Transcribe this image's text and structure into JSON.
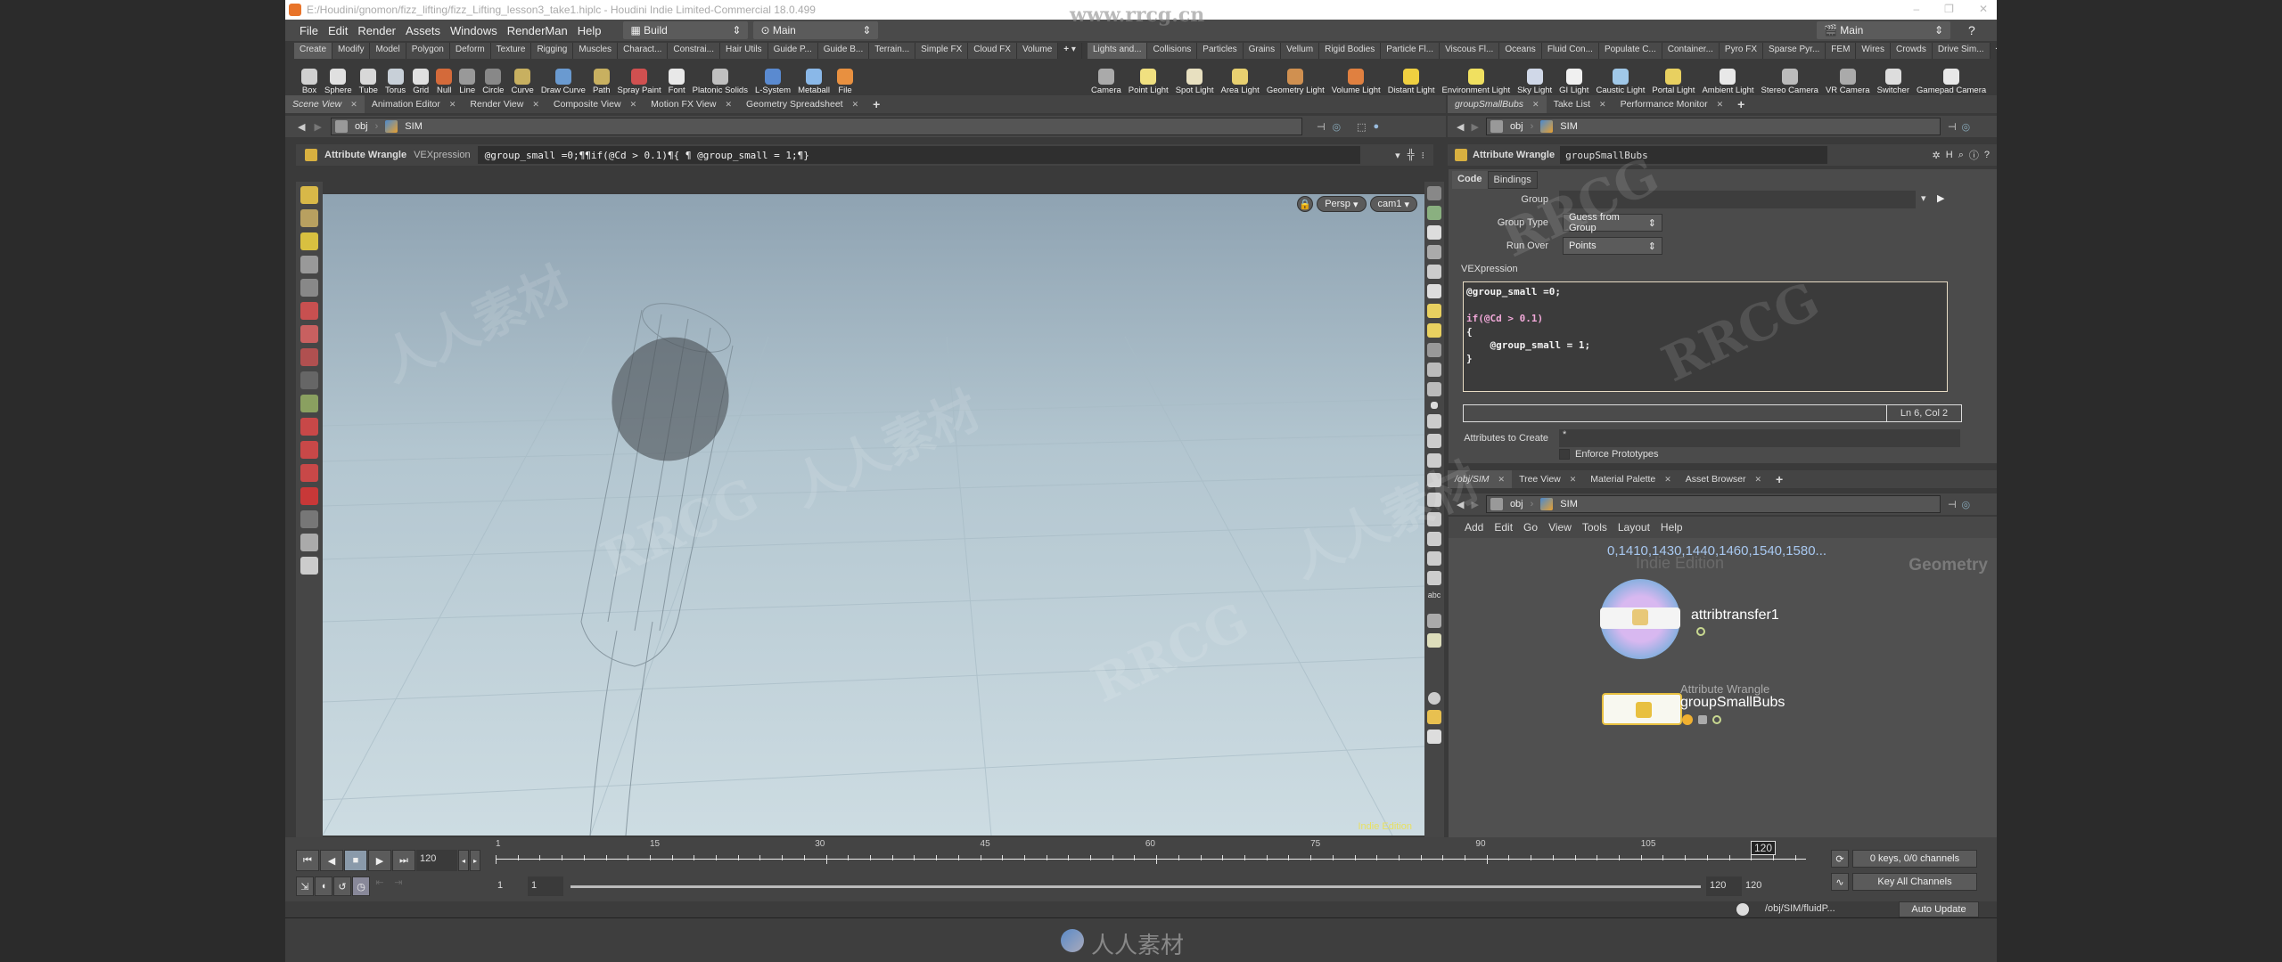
{
  "window": {
    "title": "E:/Houdini/gnomon/fizz_lifting/fizz_Lifting_lesson3_take1.hiplc - Houdini Indie Limited-Commercial 18.0.499",
    "controls": [
      "–",
      "❐",
      "✕"
    ]
  },
  "menubar": {
    "items": [
      "File",
      "Edit",
      "Render",
      "Assets",
      "Windows",
      "RenderMan",
      "Help"
    ],
    "desktop": "Build",
    "context": "Main",
    "right_context": "Main"
  },
  "shelf_tabs_left": [
    "Create",
    "Modify",
    "Model",
    "Polygon",
    "Deform",
    "Texture",
    "Rigging",
    "Muscles",
    "Charact...",
    "Constrai...",
    "Hair Utils",
    "Guide P...",
    "Guide B...",
    "Terrain...",
    "Simple FX",
    "Cloud FX",
    "Volume"
  ],
  "shelf_tabs_right": [
    "Lights and...",
    "Collisions",
    "Particles",
    "Grains",
    "Vellum",
    "Rigid Bodies",
    "Particle Fl...",
    "Viscous Fl...",
    "Oceans",
    "Fluid Con...",
    "Populate C...",
    "Container...",
    "Pyro FX",
    "Sparse Pyr...",
    "FEM",
    "Wires",
    "Crowds",
    "Drive Sim..."
  ],
  "shelf_tools_left": [
    {
      "label": "Box",
      "icon": "box-icon",
      "color": "#d0d0d0"
    },
    {
      "label": "Sphere",
      "icon": "sphere-icon",
      "color": "#e0e0e0"
    },
    {
      "label": "Tube",
      "icon": "tube-icon",
      "color": "#d8d8d8"
    },
    {
      "label": "Torus",
      "icon": "torus-icon",
      "color": "#c8d0d8"
    },
    {
      "label": "Grid",
      "icon": "grid-icon",
      "color": "#e0e0e0"
    },
    {
      "label": "Null",
      "icon": "null-icon",
      "color": "#d46a3a"
    },
    {
      "label": "Line",
      "icon": "line-icon",
      "color": "#999999"
    },
    {
      "label": "Circle",
      "icon": "circle-icon",
      "color": "#888888"
    },
    {
      "label": "Curve",
      "icon": "curve-icon",
      "color": "#c8b060"
    },
    {
      "label": "Draw Curve",
      "icon": "draw-curve-icon",
      "color": "#6a9ad0"
    },
    {
      "label": "Path",
      "icon": "path-icon",
      "color": "#c8b060"
    },
    {
      "label": "Spray Paint",
      "icon": "spray-paint-icon",
      "color": "#d05050"
    },
    {
      "label": "Font",
      "icon": "font-icon",
      "color": "#e8e8e8"
    },
    {
      "label": "Platonic Solids",
      "icon": "platonic-solids-icon",
      "color": "#c0c0c0"
    },
    {
      "label": "L-System",
      "icon": "l-system-icon",
      "color": "#5a8ad0"
    },
    {
      "label": "Metaball",
      "icon": "metaball-icon",
      "color": "#8ab8e8"
    },
    {
      "label": "File",
      "icon": "file-icon",
      "color": "#e89040"
    }
  ],
  "shelf_tools_right": [
    {
      "label": "Camera",
      "icon": "camera-icon",
      "color": "#aaaaaa"
    },
    {
      "label": "Point Light",
      "icon": "point-light-icon",
      "color": "#f0e080"
    },
    {
      "label": "Spot Light",
      "icon": "spot-light-icon",
      "color": "#e8e0c0"
    },
    {
      "label": "Area Light",
      "icon": "area-light-icon",
      "color": "#e8d070"
    },
    {
      "label": "Geometry Light",
      "icon": "geometry-light-icon",
      "color": "#d09050"
    },
    {
      "label": "Volume Light",
      "icon": "volume-light-icon",
      "color": "#e08040"
    },
    {
      "label": "Distant Light",
      "icon": "distant-light-icon",
      "color": "#f0d040"
    },
    {
      "label": "Environment Light",
      "icon": "environment-light-icon",
      "color": "#f0e060"
    },
    {
      "label": "Sky Light",
      "icon": "sky-light-icon",
      "color": "#d0d8e8"
    },
    {
      "label": "GI Light",
      "icon": "gi-light-icon",
      "color": "#f0f0f0"
    },
    {
      "label": "Caustic Light",
      "icon": "caustic-light-icon",
      "color": "#a0c8e8"
    },
    {
      "label": "Portal Light",
      "icon": "portal-light-icon",
      "color": "#e8d060"
    },
    {
      "label": "Ambient Light",
      "icon": "ambient-light-icon",
      "color": "#e8e8e8"
    },
    {
      "label": "Stereo Camera",
      "icon": "stereo-camera-icon",
      "color": "#bbbbbb"
    },
    {
      "label": "VR Camera",
      "icon": "vr-camera-icon",
      "color": "#aaaaaa"
    },
    {
      "label": "Switcher",
      "icon": "switcher-icon",
      "color": "#dddddd"
    },
    {
      "label": "Gamepad Camera",
      "icon": "gamepad-camera-icon",
      "color": "#e8e8e8"
    }
  ],
  "left_pane_tabs": [
    "Scene View",
    "Animation Editor",
    "Render View",
    "Composite View",
    "Motion FX View",
    "Geometry Spreadsheet"
  ],
  "right_top_tabs": [
    "groupSmallBubs",
    "Take List",
    "Performance Monitor"
  ],
  "right_bottom_tabs": [
    "/obj/SIM",
    "Tree View",
    "Material Palette",
    "Asset Browser"
  ],
  "path": {
    "root": "obj",
    "node": "SIM"
  },
  "viewport": {
    "op_type": "Attribute Wrangle",
    "op_field_label": "VEXpression",
    "vex_inline": "@group_small =0;¶¶if(@Cd > 0.1)¶{    ¶    @group_small = 1;¶}",
    "view_mode": "Persp",
    "camera": "cam1",
    "edition_label": "Indie Edition"
  },
  "params": {
    "op_type": "Attribute Wrangle",
    "node_name": "groupSmallBubs",
    "tabs": [
      "Code",
      "Bindings"
    ],
    "group_label": "Group",
    "group_value": "",
    "group_type_label": "Group Type",
    "group_type_value": "Guess from Group",
    "run_over_label": "Run Over",
    "run_over_value": "Points",
    "vex_label": "VEXpression",
    "code_lines": [
      "@group_small =0;",
      "",
      "if(@Cd > 0.1)",
      "{",
      "    @group_small = 1;",
      "}"
    ],
    "cursor_pos": "Ln 6, Col 2",
    "attrs_to_create_label": "Attributes to Create",
    "attrs_to_create_value": "*",
    "enforce_prototypes_label": "Enforce Prototypes",
    "enforce_prototypes": false
  },
  "network": {
    "menu": [
      "Add",
      "Edit",
      "Go",
      "View",
      "Tools",
      "Layout",
      "Help"
    ],
    "group_list_text": "0,1410,1430,1440,1460,1540,1580...",
    "watermark_edition": "Indie Edition",
    "context_label": "Geometry",
    "nodes": [
      {
        "type": "",
        "name": "attribtransfer1"
      },
      {
        "type": "Attribute Wrangle",
        "name": "groupSmallBubs"
      }
    ]
  },
  "timeline": {
    "current_frame": "120",
    "ticks": [
      "1",
      "15",
      "30",
      "45",
      "60",
      "75",
      "90",
      "105"
    ],
    "marker": "120",
    "range_start": "1",
    "range_start2": "1",
    "range_end": "120",
    "range_end2": "120",
    "keys_info": "0 keys, 0/0 channels",
    "key_mode": "Key All Channels",
    "status_path": "/obj/SIM/fluidP...",
    "update_mode": "Auto Update"
  },
  "watermarks": {
    "site": "www.rrcg.cn",
    "brand_cn": "人人素材",
    "brand_en": "RRCG"
  }
}
